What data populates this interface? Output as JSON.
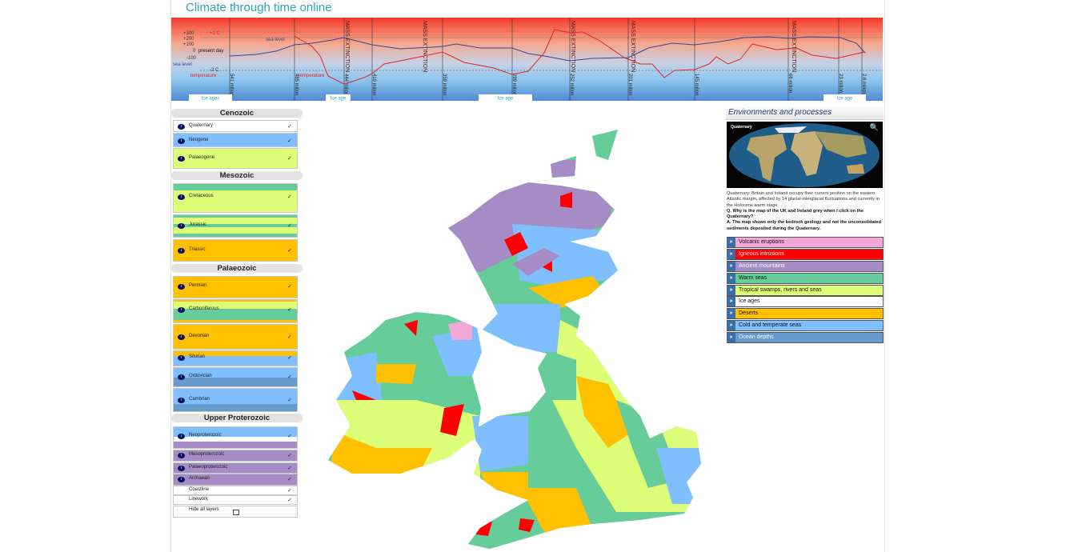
{
  "header": {
    "title": "Climate through time online"
  },
  "timeline": {
    "y_labels": {
      "p300": "+300",
      "p200": "+200",
      "p100": "+100",
      "zero": "0",
      "m100": "-100",
      "sea_level": "sea level",
      "present_day": "present day",
      "plus2": "+2 C",
      "minus2": "-2 C",
      "temperature": "temperature"
    },
    "series_labels": {
      "sea_level": "sea level",
      "temperature": "temperature"
    },
    "ticks": [
      "541 milion",
      "485 milion",
      "444 milion",
      "419 milion",
      "359 milion",
      "299 milion",
      "252 milion",
      "201 milion",
      "145 milion",
      "66 milion",
      "23 milion",
      "2.6 milion"
    ],
    "extinction_label": "MASS EXTINCTION",
    "ice_ages": [
      "Ice ages",
      "Ice age",
      "Ice age",
      "Ice age"
    ],
    "colors": {
      "sea_level": "#34489a",
      "temperature": "#e0242c"
    }
  },
  "layers": {
    "groups": [
      "Cenozoic",
      "Mesozoic",
      "Palaeozoic",
      "Upper Proterozoic"
    ],
    "items": [
      "Quaternary",
      "Neogene",
      "Palaeogene",
      "Cretaceous",
      "Jurassic",
      "Triassic",
      "Permian",
      "Carboniferous",
      "Devonian",
      "Silurian",
      "Ordovician",
      "Cambrian",
      "Neoproterozoic",
      "Mesoproterozoic",
      "Palaeoproterozoic",
      "Archaean"
    ],
    "info_icon": "i",
    "check": "✓",
    "coastline": "Coastline",
    "linework": "Linework",
    "hide_all": "Hide all layers"
  },
  "panel": {
    "title": "Environments and processes",
    "image_label": "Quaternary",
    "description": "Quaternary: Britain and Ireland occupy their current position on the eastern Atlantic margin, affected by 14 glacial-interglacial fluctuations and currently in the Holocene warm stage.",
    "question": "Q. Why is the map of the UK and Ireland grey when I click on the Quaternary?",
    "answer": "A. The map shows only the bedrock geology and not the unconsolidated sediments deposited during the Quaternary.",
    "legend": [
      {
        "label": "Volcanic eruptions",
        "color": "#f4a8d8"
      },
      {
        "label": "Igneous intrusions",
        "color": "#ff0000"
      },
      {
        "label": "Ancient mountains",
        "color": "#a58cc6"
      },
      {
        "label": "Warm seas",
        "color": "#66cc99"
      },
      {
        "label": "Tropical swamps, rivers and seas",
        "color": "#ddff77"
      },
      {
        "label": "Ice ages",
        "color": "#ffffff"
      },
      {
        "label": "Deserts",
        "color": "#ffc000"
      },
      {
        "label": "Cold and temperate seas",
        "color": "#7fbfff"
      },
      {
        "label": "Ocean depths",
        "color": "#6699cc"
      }
    ]
  }
}
